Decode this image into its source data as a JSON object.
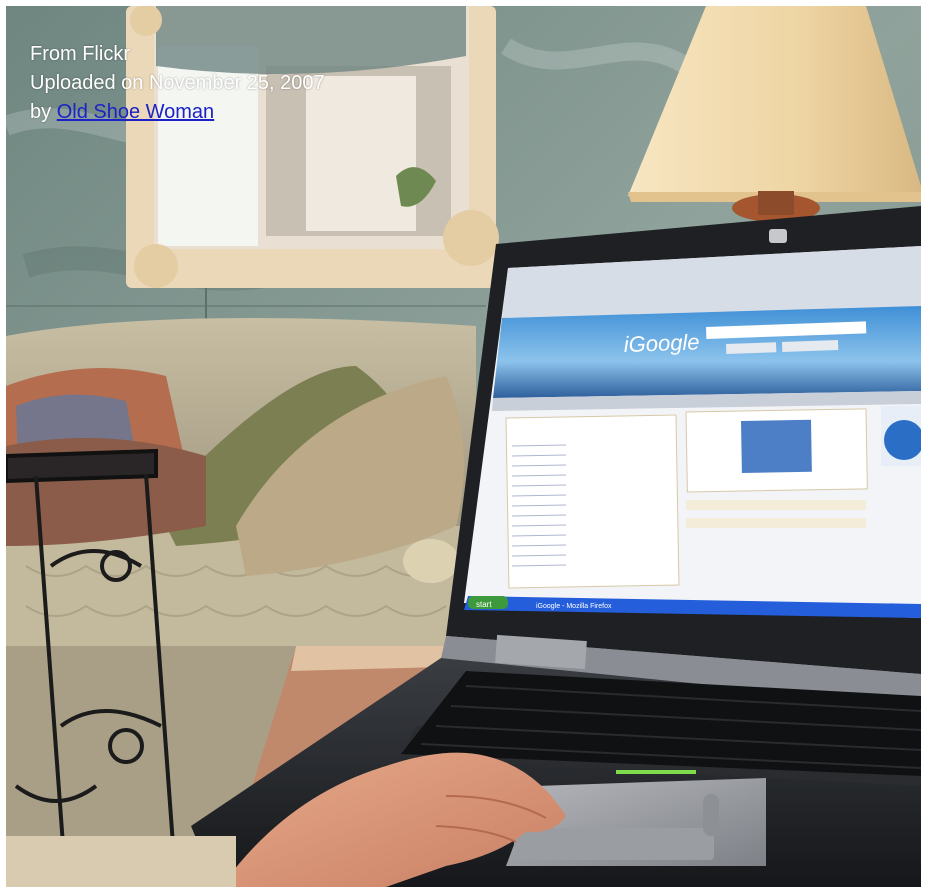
{
  "caption": {
    "line1": "From Flickr",
    "line2": "Uploaded on November 25, 2007",
    "by_prefix": "by ",
    "author": "Old Shoe Woman"
  },
  "laptop_screen": {
    "brand_logo": "iGoogle",
    "taskbar_start": "start",
    "taskbar_item": "iGoogle - Mozilla Firefox"
  },
  "colors": {
    "wall": "#8a9d96",
    "sofa": "#b8ad90",
    "lamp_shade": "#f4dfb5",
    "screen_blue": "#2d7fd0",
    "link": "#1a22c8"
  }
}
